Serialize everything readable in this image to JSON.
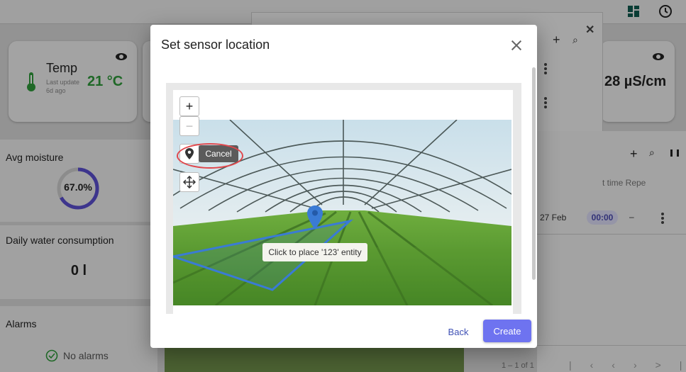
{
  "temp_card": {
    "title": "Temp",
    "value": "21 °C",
    "updated": "Last update 6d ago"
  },
  "conductivity_card": {
    "value": "28 µS/cm"
  },
  "avg_moisture": {
    "title": "Avg moisture",
    "value": "67.0%",
    "fraction": 0.67
  },
  "water": {
    "title": "Daily water consumption",
    "value": "0 l"
  },
  "alarms": {
    "title": "Alarms",
    "status": "No alarms"
  },
  "schedule_table": {
    "header_partial": "t time  Repe",
    "row": {
      "date": "27 Feb",
      "time": "00:00",
      "repeat": "–"
    },
    "paging": "1 – 1 of 1"
  },
  "dialog": {
    "title": "Set sensor location",
    "zoom_in": "+",
    "zoom_out": "−",
    "cancel_tooltip": "Cancel",
    "place_tooltip": "Click to place '123' entity",
    "back_label": "Back",
    "create_label": "Create"
  },
  "icons": {
    "dashboard": "dashboard-icon",
    "history": "history-icon",
    "thermometer": "thermometer-icon",
    "eye": "eye-icon",
    "marker": "map-marker-icon",
    "move": "move-icon",
    "check": "check-circle-icon"
  },
  "colors": {
    "accent": "#6e73f0",
    "value_green": "#2e9a3a",
    "progress": "#5b4fd0",
    "highlight": "#e0474c"
  }
}
